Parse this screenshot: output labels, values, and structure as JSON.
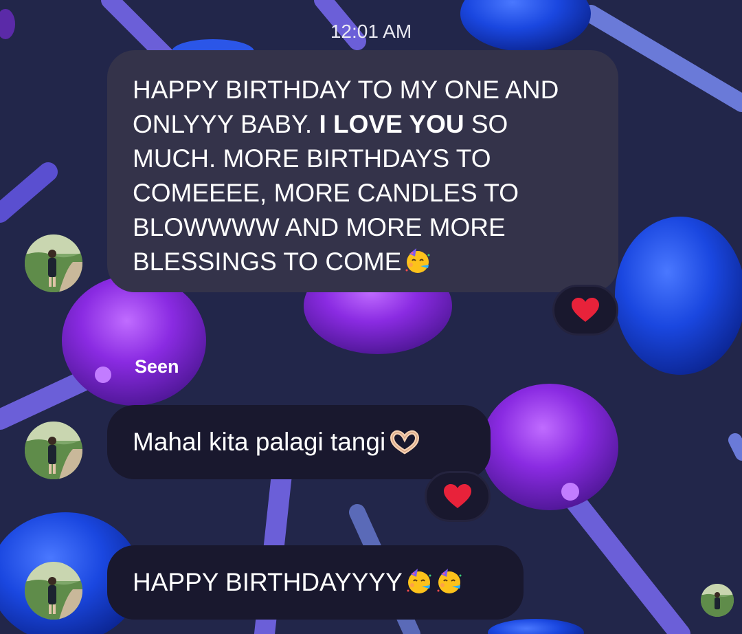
{
  "conversation": {
    "timestamp": "12:01 AM",
    "messages": [
      {
        "text_part1": "HAPPY BIRTHDAY TO MY ONE AND ONLYYY BABY. ",
        "text_bold": "I LOVE YOU",
        "text_part2": " SO MUCH. MORE BIRTHDAYS TO COMEEEE, MORE CANDLES TO BLOWWWW AND MORE MORE BLESSINGS TO COME",
        "emoji": "partying-face",
        "reaction": "red-heart"
      },
      {
        "text": "Mahal kita palagi tangi",
        "emoji": "heart-hands",
        "reaction": "red-heart"
      },
      {
        "text": "HAPPY BIRTHDAYYYY",
        "emoji": "partying-face x2"
      }
    ],
    "seen_label": "Seen"
  },
  "theme": {
    "background": "#22264a",
    "incoming_bubble_highlighted": "#34334a",
    "incoming_bubble": "#19182e",
    "heart": "#e8223a",
    "lollipop_purple": "#8a2be2",
    "lollipop_blue": "#1a47e0",
    "stick": "#6b5fd8"
  }
}
